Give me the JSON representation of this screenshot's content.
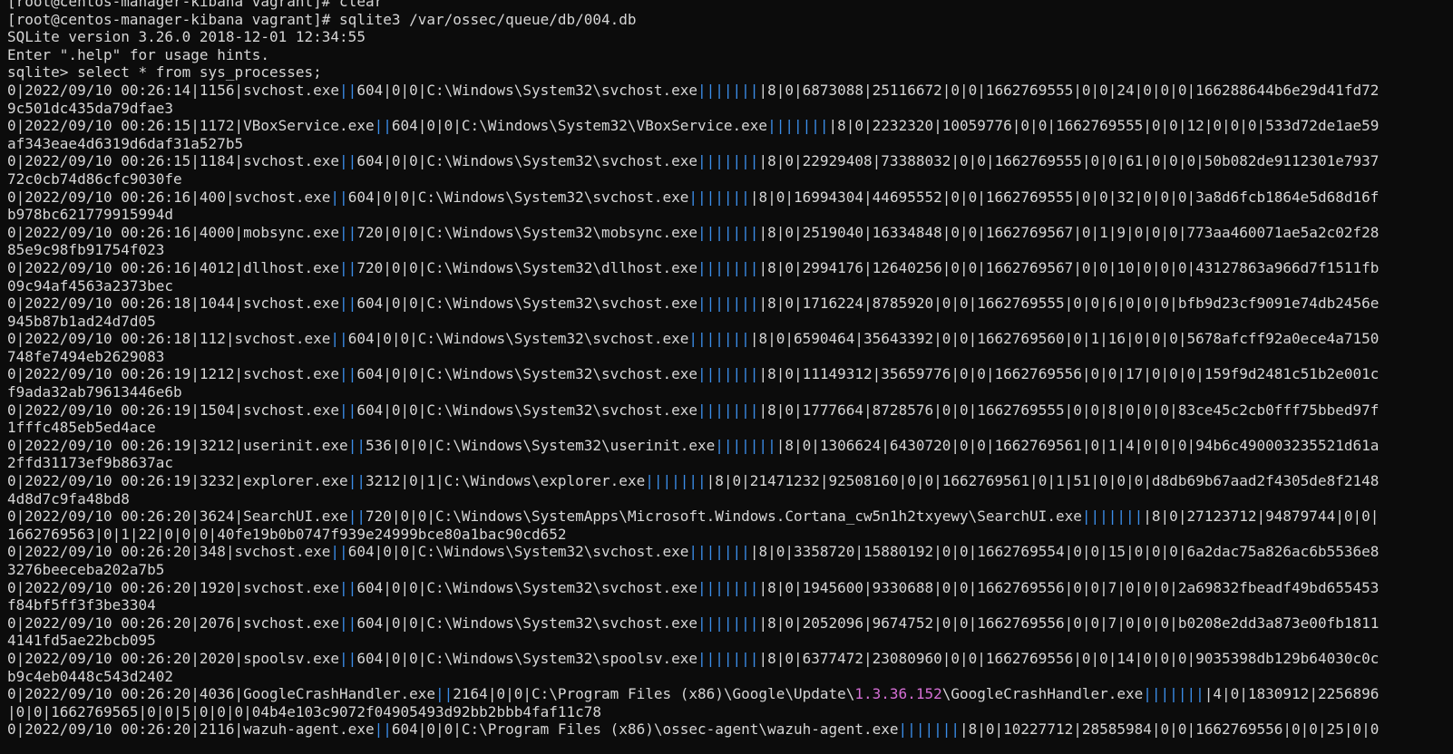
{
  "terminal": {
    "colors": {
      "background": "#0c0c0c",
      "text": "#d6d6d6",
      "separator_blue": "#3b8eea",
      "version_magenta": "#d670d6"
    },
    "lines": [
      [
        [
          "d",
          "[root@centos-manager-kibana vagrant]# clear"
        ]
      ],
      [
        [
          "d",
          "[root@centos-manager-kibana vagrant]# sqlite3 /var/ossec/queue/db/004.db"
        ]
      ],
      [
        [
          "d",
          "SQLite version 3.26.0 2018-12-01 12:34:55"
        ]
      ],
      [
        [
          "d",
          "Enter \".help\" for usage hints."
        ]
      ],
      [
        [
          "d",
          "sqlite> select * from sys_processes;"
        ]
      ],
      [
        [
          "d",
          "0|2022/09/10 00:26:14|1156|svchost.exe"
        ],
        [
          "b",
          "||"
        ],
        [
          "d",
          "604|0|0|C:\\Windows\\System32\\svchost.exe"
        ],
        [
          "b",
          "|||||||"
        ],
        [
          "d",
          "|8|0|6873088|25116672|0|0|1662769555|0|0|24|0|0|0|166288644b6e29d41fd72"
        ]
      ],
      [
        [
          "d",
          "9c501dc435da79dfae3"
        ]
      ],
      [
        [
          "d",
          "0|2022/09/10 00:26:15|1172|VBoxService.exe"
        ],
        [
          "b",
          "||"
        ],
        [
          "d",
          "604|0|0|C:\\Windows\\System32\\VBoxService.exe"
        ],
        [
          "b",
          "|||||||"
        ],
        [
          "d",
          "|8|0|2232320|10059776|0|0|1662769555|0|0|12|0|0|0|533d72de1ae59"
        ]
      ],
      [
        [
          "d",
          "af343eae4d6319d6daf31a527b5"
        ]
      ],
      [
        [
          "d",
          "0|2022/09/10 00:26:15|1184|svchost.exe"
        ],
        [
          "b",
          "||"
        ],
        [
          "d",
          "604|0|0|C:\\Windows\\System32\\svchost.exe"
        ],
        [
          "b",
          "|||||||"
        ],
        [
          "d",
          "|8|0|22929408|73388032|0|0|1662769555|0|0|61|0|0|0|50b082de9112301e7937"
        ]
      ],
      [
        [
          "d",
          "72c0cb74d86cfc9030fe"
        ]
      ],
      [
        [
          "d",
          "0|2022/09/10 00:26:16|400|svchost.exe"
        ],
        [
          "b",
          "||"
        ],
        [
          "d",
          "604|0|0|C:\\Windows\\System32\\svchost.exe"
        ],
        [
          "b",
          "|||||||"
        ],
        [
          "d",
          "|8|0|16994304|44695552|0|0|1662769555|0|0|32|0|0|0|3a8d6fcb1864e5d68d16f"
        ]
      ],
      [
        [
          "d",
          "b978bc621779915994d"
        ]
      ],
      [
        [
          "d",
          "0|2022/09/10 00:26:16|4000|mobsync.exe"
        ],
        [
          "b",
          "||"
        ],
        [
          "d",
          "720|0|0|C:\\Windows\\System32\\mobsync.exe"
        ],
        [
          "b",
          "|||||||"
        ],
        [
          "d",
          "|8|0|2519040|16334848|0|0|1662769567|0|1|9|0|0|0|773aa460071ae5a2c02f28"
        ]
      ],
      [
        [
          "d",
          "85e9c98fb91754f023"
        ]
      ],
      [
        [
          "d",
          "0|2022/09/10 00:26:16|4012|dllhost.exe"
        ],
        [
          "b",
          "||"
        ],
        [
          "d",
          "720|0|0|C:\\Windows\\System32\\dllhost.exe"
        ],
        [
          "b",
          "|||||||"
        ],
        [
          "d",
          "|8|0|2994176|12640256|0|0|1662769567|0|0|10|0|0|0|43127863a966d7f1511fb"
        ]
      ],
      [
        [
          "d",
          "09c94af4563a2373bec"
        ]
      ],
      [
        [
          "d",
          "0|2022/09/10 00:26:18|1044|svchost.exe"
        ],
        [
          "b",
          "||"
        ],
        [
          "d",
          "604|0|0|C:\\Windows\\System32\\svchost.exe"
        ],
        [
          "b",
          "|||||||"
        ],
        [
          "d",
          "|8|0|1716224|8785920|0|0|1662769555|0|0|6|0|0|0|bfb9d23cf9091e74db2456e"
        ]
      ],
      [
        [
          "d",
          "945b87b1ad24d7d05"
        ]
      ],
      [
        [
          "d",
          "0|2022/09/10 00:26:18|112|svchost.exe"
        ],
        [
          "b",
          "||"
        ],
        [
          "d",
          "604|0|0|C:\\Windows\\System32\\svchost.exe"
        ],
        [
          "b",
          "|||||||"
        ],
        [
          "d",
          "|8|0|6590464|35643392|0|0|1662769560|0|1|16|0|0|0|5678afcff92a0ece4a7150"
        ]
      ],
      [
        [
          "d",
          "748fe7494eb2629083"
        ]
      ],
      [
        [
          "d",
          "0|2022/09/10 00:26:19|1212|svchost.exe"
        ],
        [
          "b",
          "||"
        ],
        [
          "d",
          "604|0|0|C:\\Windows\\System32\\svchost.exe"
        ],
        [
          "b",
          "|||||||"
        ],
        [
          "d",
          "|8|0|11149312|35659776|0|0|1662769556|0|0|17|0|0|0|159f9d2481c51b2e001c"
        ]
      ],
      [
        [
          "d",
          "f9ada32ab79613446e6b"
        ]
      ],
      [
        [
          "d",
          "0|2022/09/10 00:26:19|1504|svchost.exe"
        ],
        [
          "b",
          "||"
        ],
        [
          "d",
          "604|0|0|C:\\Windows\\System32\\svchost.exe"
        ],
        [
          "b",
          "|||||||"
        ],
        [
          "d",
          "|8|0|1777664|8728576|0|0|1662769555|0|0|8|0|0|0|83ce45c2cb0fff75bbed97f"
        ]
      ],
      [
        [
          "d",
          "1fffc485eb5ed4ace"
        ]
      ],
      [
        [
          "d",
          "0|2022/09/10 00:26:19|3212|userinit.exe"
        ],
        [
          "b",
          "||"
        ],
        [
          "d",
          "536|0|0|C:\\Windows\\System32\\userinit.exe"
        ],
        [
          "b",
          "|||||||"
        ],
        [
          "d",
          "|8|0|1306624|6430720|0|0|1662769561|0|1|4|0|0|0|94b6c490003235521d61a"
        ]
      ],
      [
        [
          "d",
          "2ffd31173ef9b8637ac"
        ]
      ],
      [
        [
          "d",
          "0|2022/09/10 00:26:19|3232|explorer.exe"
        ],
        [
          "b",
          "||"
        ],
        [
          "d",
          "3212|0|1|C:\\Windows\\explorer.exe"
        ],
        [
          "b",
          "|||||||"
        ],
        [
          "d",
          "|8|0|21471232|92508160|0|0|1662769561|0|1|51|0|0|0|d8db69b67aad2f4305de8f2148"
        ]
      ],
      [
        [
          "d",
          "4d8d7c9fa48bd8"
        ]
      ],
      [
        [
          "d",
          "0|2022/09/10 00:26:20|3624|SearchUI.exe"
        ],
        [
          "b",
          "||"
        ],
        [
          "d",
          "720|0|0|C:\\Windows\\SystemApps\\Microsoft.Windows.Cortana_cw5n1h2txyewy\\SearchUI.exe"
        ],
        [
          "b",
          "|||||||"
        ],
        [
          "d",
          "|8|0|27123712|94879744|0|0|"
        ]
      ],
      [
        [
          "d",
          "1662769563|0|1|22|0|0|0|40fe19b0b0747f939e24999bce80a1bac90cd652"
        ]
      ],
      [
        [
          "d",
          "0|2022/09/10 00:26:20|348|svchost.exe"
        ],
        [
          "b",
          "||"
        ],
        [
          "d",
          "604|0|0|C:\\Windows\\System32\\svchost.exe"
        ],
        [
          "b",
          "|||||||"
        ],
        [
          "d",
          "|8|0|3358720|15880192|0|0|1662769554|0|0|15|0|0|0|6a2dac75a826ac6b5536e8"
        ]
      ],
      [
        [
          "d",
          "3276beeceba202a7b5"
        ]
      ],
      [
        [
          "d",
          "0|2022/09/10 00:26:20|1920|svchost.exe"
        ],
        [
          "b",
          "||"
        ],
        [
          "d",
          "604|0|0|C:\\Windows\\System32\\svchost.exe"
        ],
        [
          "b",
          "|||||||"
        ],
        [
          "d",
          "|8|0|1945600|9330688|0|0|1662769556|0|0|7|0|0|0|2a69832fbeadf49bd655453"
        ]
      ],
      [
        [
          "d",
          "f84bf5ff3f3be3304"
        ]
      ],
      [
        [
          "d",
          "0|2022/09/10 00:26:20|2076|svchost.exe"
        ],
        [
          "b",
          "||"
        ],
        [
          "d",
          "604|0|0|C:\\Windows\\System32\\svchost.exe"
        ],
        [
          "b",
          "|||||||"
        ],
        [
          "d",
          "|8|0|2052096|9674752|0|0|1662769556|0|0|7|0|0|0|b0208e2dd3a873e00fb1811"
        ]
      ],
      [
        [
          "d",
          "4141fd5ae22bcb095"
        ]
      ],
      [
        [
          "d",
          "0|2022/09/10 00:26:20|2020|spoolsv.exe"
        ],
        [
          "b",
          "||"
        ],
        [
          "d",
          "604|0|0|C:\\Windows\\System32\\spoolsv.exe"
        ],
        [
          "b",
          "|||||||"
        ],
        [
          "d",
          "|8|0|6377472|23080960|0|0|1662769556|0|0|14|0|0|0|9035398db129b64030c0c"
        ]
      ],
      [
        [
          "d",
          "b9c4eb0448c543d2402"
        ]
      ],
      [
        [
          "d",
          "0|2022/09/10 00:26:20|4036|GoogleCrashHandler.exe"
        ],
        [
          "b",
          "||"
        ],
        [
          "d",
          "2164|0|0|C:\\Program Files (x86)\\Google\\Update\\"
        ],
        [
          "m",
          "1.3.36.152"
        ],
        [
          "d",
          "\\GoogleCrashHandler.exe"
        ],
        [
          "b",
          "|||||||"
        ],
        [
          "d",
          "|4|0|1830912|2256896"
        ]
      ],
      [
        [
          "d",
          "|0|0|1662769565|0|0|5|0|0|0|04b4e103c9072f04905493d92bb2bbb4faf11c78"
        ]
      ],
      [
        [
          "d",
          "0|2022/09/10 00:26:20|2116|wazuh-agent.exe"
        ],
        [
          "b",
          "||"
        ],
        [
          "d",
          "604|0|0|C:\\Program Files (x86)\\ossec-agent\\wazuh-agent.exe"
        ],
        [
          "b",
          "|||||||"
        ],
        [
          "d",
          "|8|0|10227712|28585984|0|0|1662769556|0|0|25|0|0"
        ]
      ]
    ]
  }
}
